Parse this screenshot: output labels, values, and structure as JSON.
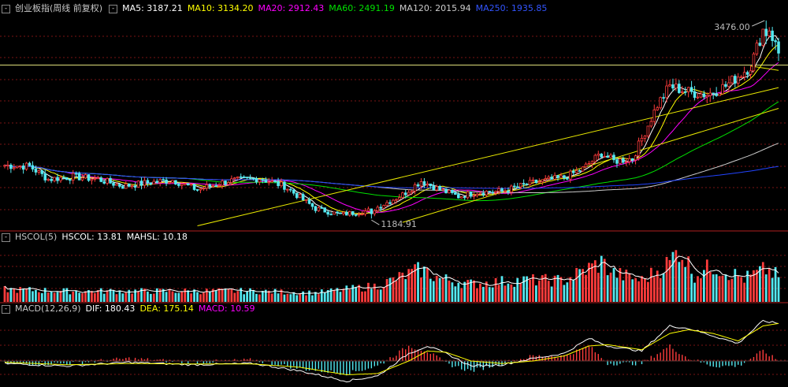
{
  "main_legend": {
    "title": "创业板指(周线 前复权)",
    "ma5": "MA5: 3187.21",
    "ma10": "MA10: 3134.20",
    "ma20": "MA20: 2912.43",
    "ma60": "MA60: 2491.19",
    "ma120": "MA120: 2015.94",
    "ma250": "MA250: 1935.85"
  },
  "vol_legend": {
    "title": "HSCOL(5)",
    "hscol": "HSCOL: 13.81",
    "mahsl": "MAHSL: 10.18"
  },
  "macd_legend": {
    "title": "MACD(12,26,9)",
    "dif": "DIF: 180.43",
    "dea": "DEA: 175.14",
    "macd": "MACD: 10.59"
  },
  "annotations": {
    "high": "3476.00",
    "low": "1184.91"
  },
  "colors": {
    "up": "#ff3c3c",
    "down": "#54e8f0",
    "ma5": "#ffffff",
    "ma10": "#ffff00",
    "ma20": "#ff00ff",
    "ma60": "#00e000",
    "ma120": "#cccccc",
    "ma250": "#2244ff",
    "trend": "#e8e800",
    "grid": "#7a1515"
  },
  "chart_data": [
    {
      "type": "candlestick",
      "title": "创业板指(周线 前复权)",
      "ylim": [
        1050,
        3550
      ],
      "anchors": {
        "close": [
          [
            0,
            1800
          ],
          [
            8,
            1790
          ],
          [
            14,
            1640
          ],
          [
            22,
            1670
          ],
          [
            30,
            1640
          ],
          [
            38,
            1560
          ],
          [
            46,
            1600
          ],
          [
            54,
            1630
          ],
          [
            62,
            1520
          ],
          [
            72,
            1620
          ],
          [
            82,
            1650
          ],
          [
            90,
            1560
          ],
          [
            100,
            1300
          ],
          [
            108,
            1230
          ],
          [
            118,
            1280
          ],
          [
            128,
            1460
          ],
          [
            134,
            1620
          ],
          [
            140,
            1520
          ],
          [
            146,
            1440
          ],
          [
            152,
            1490
          ],
          [
            160,
            1500
          ],
          [
            170,
            1600
          ],
          [
            180,
            1660
          ],
          [
            186,
            1760
          ],
          [
            192,
            1940
          ],
          [
            196,
            1850
          ],
          [
            202,
            1880
          ],
          [
            210,
            2500
          ],
          [
            214,
            2720
          ],
          [
            220,
            2650
          ],
          [
            226,
            2620
          ],
          [
            232,
            2720
          ],
          [
            240,
            2950
          ],
          [
            245,
            3476
          ],
          [
            249,
            3100
          ]
        ],
        "vol": [
          [
            0,
            7
          ],
          [
            20,
            6
          ],
          [
            40,
            6
          ],
          [
            60,
            6
          ],
          [
            80,
            6
          ],
          [
            100,
            5
          ],
          [
            110,
            7
          ],
          [
            120,
            9
          ],
          [
            134,
            18
          ],
          [
            140,
            13
          ],
          [
            150,
            10
          ],
          [
            165,
            12
          ],
          [
            180,
            12
          ],
          [
            186,
            17
          ],
          [
            192,
            22
          ],
          [
            196,
            16
          ],
          [
            205,
            12
          ],
          [
            214,
            22
          ],
          [
            217,
            30
          ],
          [
            222,
            15
          ],
          [
            228,
            20
          ],
          [
            238,
            13
          ],
          [
            245,
            18
          ],
          [
            249,
            14
          ]
        ],
        "macd_dif": [
          [
            0,
            -10
          ],
          [
            20,
            -20
          ],
          [
            40,
            -5
          ],
          [
            60,
            -15
          ],
          [
            80,
            -10
          ],
          [
            95,
            -40
          ],
          [
            110,
            -80
          ],
          [
            120,
            -60
          ],
          [
            130,
            30
          ],
          [
            136,
            60
          ],
          [
            142,
            30
          ],
          [
            150,
            -20
          ],
          [
            160,
            -15
          ],
          [
            170,
            10
          ],
          [
            180,
            30
          ],
          [
            188,
            90
          ],
          [
            194,
            60
          ],
          [
            205,
            40
          ],
          [
            214,
            140
          ],
          [
            220,
            130
          ],
          [
            228,
            100
          ],
          [
            236,
            70
          ],
          [
            244,
            160
          ],
          [
            249,
            150
          ]
        ],
        "macd_dea": [
          [
            0,
            -5
          ],
          [
            20,
            -15
          ],
          [
            40,
            -10
          ],
          [
            60,
            -12
          ],
          [
            80,
            -12
          ],
          [
            95,
            -25
          ],
          [
            110,
            -55
          ],
          [
            120,
            -50
          ],
          [
            130,
            0
          ],
          [
            136,
            40
          ],
          [
            142,
            35
          ],
          [
            150,
            0
          ],
          [
            160,
            -10
          ],
          [
            170,
            0
          ],
          [
            180,
            20
          ],
          [
            188,
            60
          ],
          [
            194,
            65
          ],
          [
            205,
            45
          ],
          [
            214,
            110
          ],
          [
            220,
            125
          ],
          [
            228,
            110
          ],
          [
            236,
            80
          ],
          [
            244,
            140
          ],
          [
            249,
            150
          ]
        ]
      },
      "trendlines": [
        {
          "from": [
            62,
            1100
          ],
          "to": [
            249,
            2700
          ]
        },
        {
          "from": [
            128,
            1140
          ],
          "to": [
            249,
            2460
          ]
        },
        {
          "from": [
            240,
            2950
          ],
          "to": [
            249,
            2900
          ]
        }
      ],
      "hline": 2960,
      "high": {
        "index": 245,
        "value": 3476
      },
      "low": {
        "index": 118,
        "value": 1184.91
      }
    }
  ]
}
